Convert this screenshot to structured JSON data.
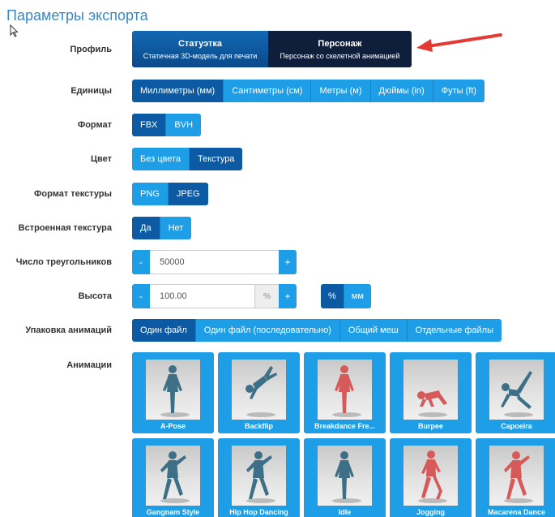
{
  "page_title": "Параметры экспорта",
  "colors": {
    "accent": "#1e9ee6",
    "accent_active": "#0b5aa3",
    "profile_dark": "#0f1e3a",
    "title": "#3a87c5",
    "arrow": "#e53935",
    "figure_teal": "#3d6f86",
    "figure_red": "#d75a5a"
  },
  "profile": {
    "label": "Профиль",
    "options": [
      {
        "title": "Статуэтка",
        "subtitle": "Статичная 3D-модель для печати"
      },
      {
        "title": "Персонаж",
        "subtitle": "Персонаж со скелетной анимацией"
      }
    ],
    "selected": "Персонаж"
  },
  "units": {
    "label": "Единицы",
    "options": [
      "Миллиметры (мм)",
      "Сантиметры (см)",
      "Метры (м)",
      "Дюймы (in)",
      "Футы (ft)"
    ],
    "selected": "Миллиметры (мм)"
  },
  "format": {
    "label": "Формат",
    "options": [
      "FBX",
      "BVH"
    ],
    "selected": "FBX"
  },
  "color": {
    "label": "Цвет",
    "options": [
      "Без цвета",
      "Текстура"
    ],
    "selected": "Текстура"
  },
  "texture_format": {
    "label": "Формат текстуры",
    "options": [
      "PNG",
      "JPEG"
    ],
    "selected": "JPEG"
  },
  "embedded_texture": {
    "label": "Встроенная текстура",
    "options": [
      "Да",
      "Нет"
    ],
    "selected": "Да"
  },
  "triangles": {
    "label": "Число треугольников",
    "value": "50000",
    "minus": "-",
    "plus": "+"
  },
  "height": {
    "label": "Высота",
    "value": "100.00",
    "unit_addon": "%",
    "minus": "-",
    "plus": "+",
    "unit_options": [
      "%",
      "мм"
    ],
    "unit_selected": "%"
  },
  "anim_packing": {
    "label": "Упаковка анимаций",
    "options": [
      "Один файл",
      "Один файл (последовательно)",
      "Общий меш",
      "Отдельные файлы"
    ],
    "selected": "Один файл"
  },
  "animations": {
    "label": "Анимации",
    "items": [
      {
        "name": "A-Pose",
        "color": "teal",
        "pose": "stand"
      },
      {
        "name": "Backflip",
        "color": "teal",
        "pose": "flip"
      },
      {
        "name": "Breakdance Fre...",
        "color": "red",
        "pose": "stand"
      },
      {
        "name": "Burpee",
        "color": "red",
        "pose": "crouch"
      },
      {
        "name": "Capoeira",
        "color": "teal",
        "pose": "kick"
      },
      {
        "name": "Gangnam Style",
        "color": "teal",
        "pose": "dance"
      },
      {
        "name": "Hip Hop Dancing",
        "color": "teal",
        "pose": "dance"
      },
      {
        "name": "Idle",
        "color": "teal",
        "pose": "stand"
      },
      {
        "name": "Jogging",
        "color": "red",
        "pose": "run"
      },
      {
        "name": "Macarena Dance",
        "color": "red",
        "pose": "dance"
      }
    ]
  }
}
